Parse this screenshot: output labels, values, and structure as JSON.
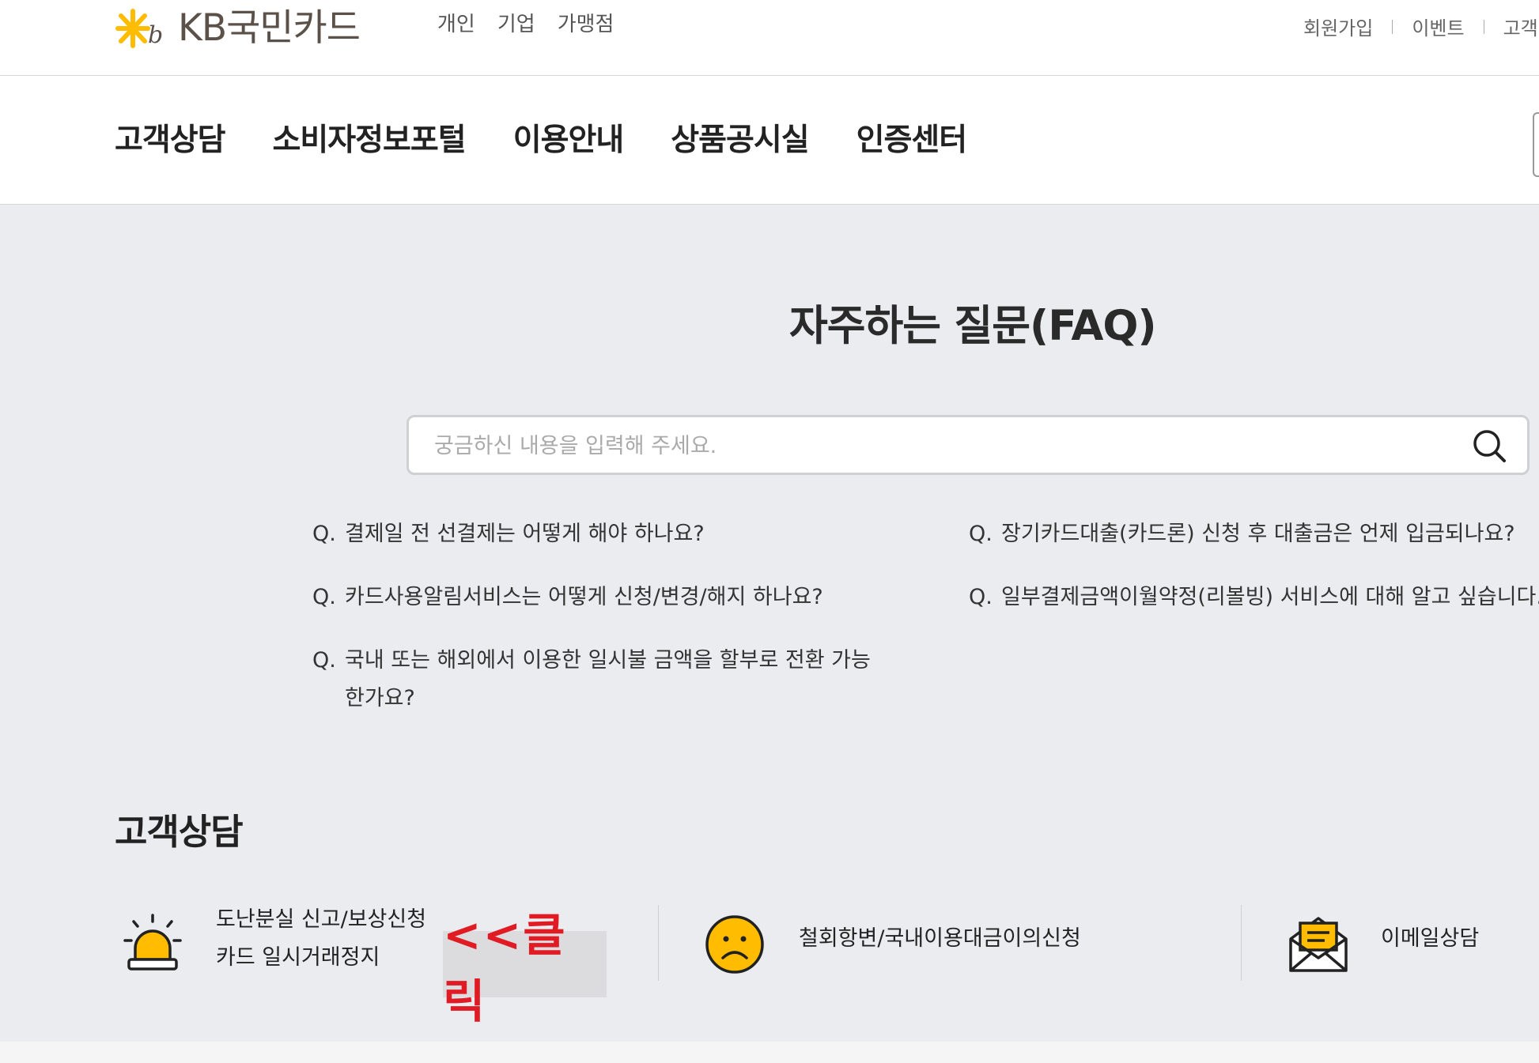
{
  "header": {
    "brand": "KB국민카드",
    "segments": [
      "개인",
      "기업",
      "가맹점"
    ],
    "utility": [
      "회원가입",
      "이벤트",
      "고객센터"
    ]
  },
  "main_nav": [
    "고객상담",
    "소비자정보포털",
    "이용안내",
    "상품공시실",
    "인증센터"
  ],
  "faq": {
    "title": "자주하는 질문(FAQ)",
    "search_placeholder": "궁금하신 내용을 입력해 주세요.",
    "q_label": "Q.",
    "questions": [
      "결제일 전 선결제는 어떻게 해야 하나요?",
      "장기카드대출(카드론) 신청 후 대출금은 언제 입금되나요?",
      "카드사용알림서비스는 어떻게 신청/변경/해지 하나요?",
      "일부결제금액이월약정(리볼빙) 서비스에 대해 알고 싶습니다.",
      "국내 또는 해외에서 이용한 일시불 금액을 할부로 전환 가능한가요?"
    ]
  },
  "customer_service": {
    "title": "고객상담",
    "items": [
      {
        "line1": "도난분실 신고/보상신청",
        "line2": "카드 일시거래정지",
        "icon": "alarm-light-icon"
      },
      {
        "line1": "철회항변/국내이용대금이의신청",
        "icon": "sad-face-icon"
      },
      {
        "line1": "이메일상담",
        "icon": "email-icon"
      }
    ]
  },
  "annotation": {
    "text": "<<클릭",
    "color": "#e01b24"
  },
  "colors": {
    "brand_yellow": "#ffbc00",
    "brand_gray": "#5b5149",
    "background": "#ebecef"
  }
}
